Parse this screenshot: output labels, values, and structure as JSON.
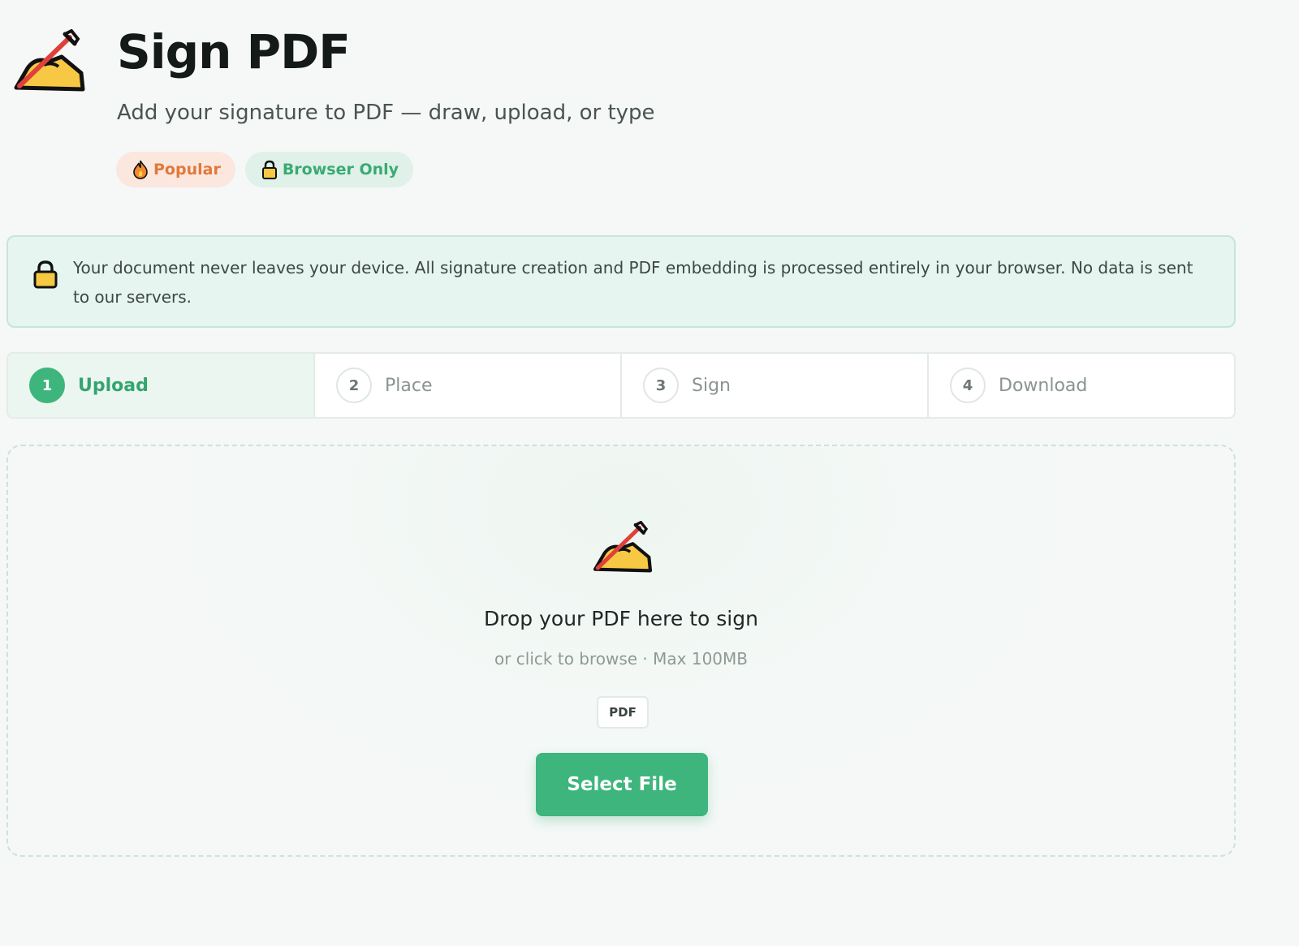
{
  "header": {
    "icon": "writing-hand-icon",
    "title": "Sign PDF",
    "subtitle": "Add your signature to PDF — draw, upload, or type",
    "badges": [
      {
        "icon": "fire-icon",
        "label": "Popular",
        "color": "#e0793a"
      },
      {
        "icon": "lock-icon",
        "label": "Browser Only",
        "color": "#3aaa74"
      }
    ]
  },
  "notice": {
    "icon": "lock-icon",
    "text": "Your document never leaves your device. All signature creation and PDF embedding is processed entirely in your browser. No data is sent to our servers."
  },
  "steps": [
    {
      "number": "1",
      "label": "Upload",
      "active": true
    },
    {
      "number": "2",
      "label": "Place",
      "active": false
    },
    {
      "number": "3",
      "label": "Sign",
      "active": false
    },
    {
      "number": "4",
      "label": "Download",
      "active": false
    }
  ],
  "dropzone": {
    "icon": "writing-hand-icon",
    "title": "Drop your PDF here to sign",
    "subtitle": "or click to browse · Max 100MB",
    "accepted_format": "PDF",
    "button_label": "Select File"
  },
  "colors": {
    "accent": "#3db57c",
    "background": "#f5f8f7"
  }
}
